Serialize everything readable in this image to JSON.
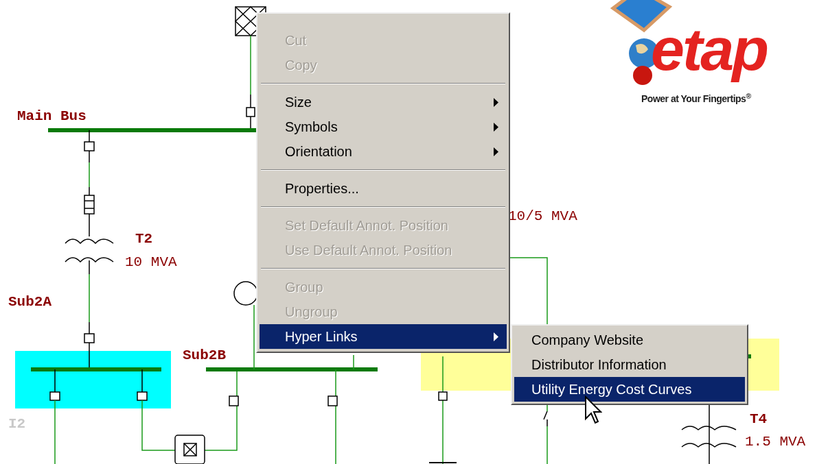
{
  "diagram": {
    "labels": [
      {
        "kind": "bus",
        "text": "Main Bus"
      },
      {
        "kind": "bus",
        "text": "T2"
      },
      {
        "kind": "rating",
        "text": "10 MVA"
      },
      {
        "kind": "bus",
        "text": "Sub2A"
      },
      {
        "kind": "faded",
        "text": "I2"
      },
      {
        "kind": "bus",
        "text": "Sub2B"
      },
      {
        "kind": "rating",
        "text": "10/5 MVA"
      },
      {
        "kind": "bus",
        "text": "T4"
      },
      {
        "kind": "rating",
        "text": "1.5 MVA"
      }
    ]
  },
  "logo": {
    "wordmark": "etap",
    "tagline": "Power at Your Fingertips$^{®}$"
  },
  "context_menu": {
    "items": [
      {
        "kind": "item",
        "label": "Cut",
        "disabled": true,
        "submenu": false,
        "selected": false
      },
      {
        "kind": "item",
        "label": "Copy",
        "disabled": true,
        "submenu": false,
        "selected": false
      },
      {
        "kind": "separator"
      },
      {
        "kind": "item",
        "label": "Size",
        "disabled": false,
        "submenu": true,
        "selected": false
      },
      {
        "kind": "item",
        "label": "Symbols",
        "disabled": false,
        "submenu": true,
        "selected": false
      },
      {
        "kind": "item",
        "label": "Orientation",
        "disabled": false,
        "submenu": true,
        "selected": false
      },
      {
        "kind": "separator"
      },
      {
        "kind": "item",
        "label": "Properties...",
        "disabled": false,
        "submenu": false,
        "selected": false
      },
      {
        "kind": "separator"
      },
      {
        "kind": "item",
        "label": "Set Default Annot. Position",
        "disabled": true,
        "submenu": false,
        "selected": false
      },
      {
        "kind": "item",
        "label": "Use Default Annot. Position",
        "disabled": true,
        "submenu": false,
        "selected": false
      },
      {
        "kind": "separator"
      },
      {
        "kind": "item",
        "label": "Group",
        "disabled": true,
        "submenu": false,
        "selected": false
      },
      {
        "kind": "item",
        "label": "Ungroup",
        "disabled": true,
        "submenu": false,
        "selected": false
      },
      {
        "kind": "item",
        "label": "Hyper Links",
        "disabled": false,
        "submenu": true,
        "selected": true
      }
    ]
  },
  "submenu": {
    "items": [
      {
        "label": "Company Website",
        "selected": false
      },
      {
        "label": "Distributor Information",
        "selected": false
      },
      {
        "label": "Utility Energy Cost Curves",
        "selected": true
      }
    ]
  }
}
